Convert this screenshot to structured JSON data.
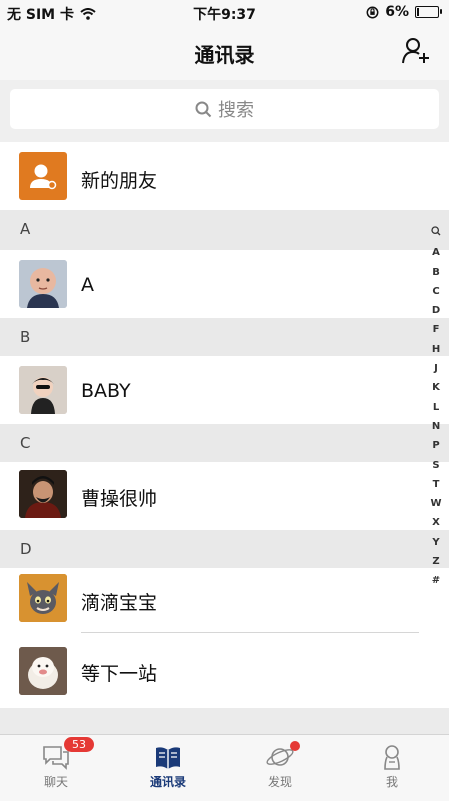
{
  "status_bar": {
    "carrier": "无 SIM 卡",
    "time": "下午9:37",
    "battery": "6%"
  },
  "nav": {
    "title": "通讯录"
  },
  "search": {
    "placeholder": "搜索"
  },
  "new_friends": {
    "label": "新的朋友"
  },
  "sections": [
    {
      "letter": "A",
      "contacts": [
        {
          "name": "A"
        }
      ]
    },
    {
      "letter": "B",
      "contacts": [
        {
          "name": "BABY"
        }
      ]
    },
    {
      "letter": "C",
      "contacts": [
        {
          "name": "曹操很帅"
        }
      ]
    },
    {
      "letter": "D",
      "contacts": [
        {
          "name": "滴滴宝宝"
        },
        {
          "name": "等下一站"
        }
      ]
    }
  ],
  "index_letters": [
    "A",
    "B",
    "C",
    "D",
    "F",
    "H",
    "J",
    "K",
    "L",
    "N",
    "P",
    "S",
    "T",
    "W",
    "X",
    "Y",
    "Z",
    "#"
  ],
  "tabs": [
    {
      "label": "聊天",
      "badge": "53"
    },
    {
      "label": "通讯录"
    },
    {
      "label": "发现"
    },
    {
      "label": "我"
    }
  ],
  "colors": {
    "accent": "#1a3a78",
    "badge": "#e53935",
    "new_friend_bg": "#e07a20"
  }
}
